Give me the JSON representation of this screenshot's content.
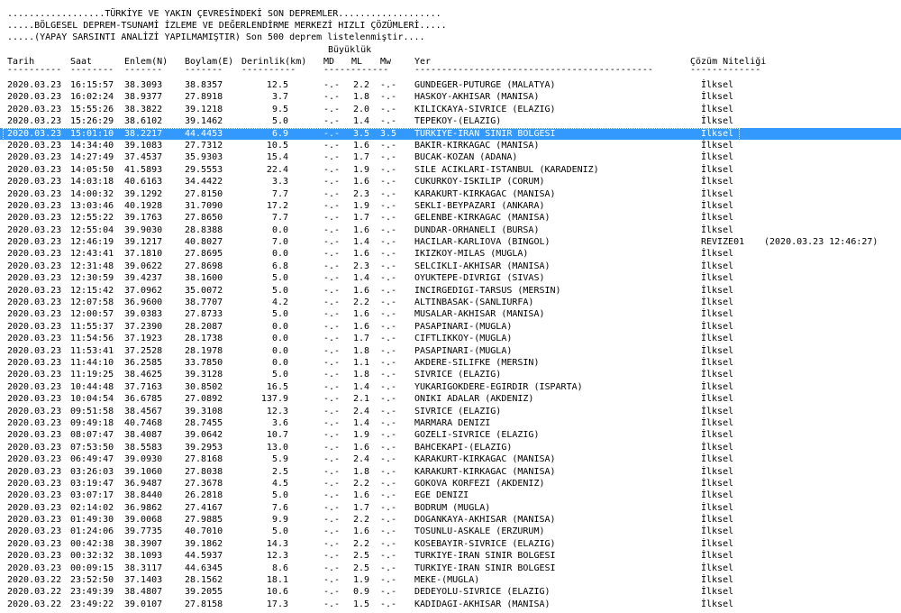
{
  "header": {
    "line1": "..................TÜRKİYE VE YAKIN ÇEVRESİNDEKİ SON DEPREMLER...................",
    "line2": ".....BÖLGESEL DEPREM-TSUNAMİ İZLEME VE DEĞERLENDİRME MERKEZİ HIZLI ÇÖZÜMLERİ.....",
    "line3": ".....(YAPAY SARSINTI ANALİZİ YAPILMAMIŞTIR) Son 500 deprem listelenmiştir....",
    "buyukluk": "Büyüklük"
  },
  "columns": {
    "tarih": "Tarih",
    "saat": "Saat",
    "enlem": "Enlem(N)",
    "boylam": "Boylam(E)",
    "derinlik": "Derinlik(km)",
    "md": "MD",
    "ml": "ML",
    "mw": "Mw",
    "yer": "Yer",
    "cozum": "Çözüm Niteliği"
  },
  "dashes": {
    "tarih": "----------",
    "saat": "--------",
    "enlem": "-------",
    "boylam": "-------",
    "derinlik": "----------",
    "mag": "------------",
    "yer": "--------------------------------------------",
    "cozum": "-------------"
  },
  "selected_row_index": 4,
  "rows": [
    {
      "tarih": "2020.03.23",
      "saat": "16:15:57",
      "enlem": "38.3093",
      "boylam": "38.8357",
      "derinlik": "12.5",
      "md": "-.-",
      "ml": "2.2",
      "mw": "-.-",
      "yer": "GUNDEGER-PUTURGE (MALATYA)",
      "cozum": "İlksel",
      "revize": ""
    },
    {
      "tarih": "2020.03.23",
      "saat": "16:02:24",
      "enlem": "38.9377",
      "boylam": "27.8918",
      "derinlik": "3.7",
      "md": "-.-",
      "ml": "1.8",
      "mw": "-.-",
      "yer": "HASKOY-AKHISAR (MANISA)",
      "cozum": "İlksel",
      "revize": ""
    },
    {
      "tarih": "2020.03.23",
      "saat": "15:55:26",
      "enlem": "38.3822",
      "boylam": "39.1218",
      "derinlik": "9.5",
      "md": "-.-",
      "ml": "2.0",
      "mw": "-.-",
      "yer": "KILICKAYA-SIVRICE (ELAZIG)",
      "cozum": "İlksel",
      "revize": ""
    },
    {
      "tarih": "2020.03.23",
      "saat": "15:26:29",
      "enlem": "38.6102",
      "boylam": "39.1462",
      "derinlik": "5.0",
      "md": "-.-",
      "ml": "1.4",
      "mw": "-.-",
      "yer": "TEPEKOY-(ELAZIG)",
      "cozum": "İlksel",
      "revize": ""
    },
    {
      "tarih": "2020.03.23",
      "saat": "15:01:10",
      "enlem": "38.2217",
      "boylam": "44.4453",
      "derinlik": "6.9",
      "md": "-.-",
      "ml": "3.5",
      "mw": "3.5",
      "yer": "TURKIYE-IRAN SINIR BOLGESI",
      "cozum": "İlksel",
      "revize": ""
    },
    {
      "tarih": "2020.03.23",
      "saat": "14:34:40",
      "enlem": "39.1083",
      "boylam": "27.7312",
      "derinlik": "10.5",
      "md": "-.-",
      "ml": "1.6",
      "mw": "-.-",
      "yer": "BAKIR-KIRKAGAC (MANISA)",
      "cozum": "İlksel",
      "revize": ""
    },
    {
      "tarih": "2020.03.23",
      "saat": "14:27:49",
      "enlem": "37.4537",
      "boylam": "35.9303",
      "derinlik": "15.4",
      "md": "-.-",
      "ml": "1.7",
      "mw": "-.-",
      "yer": "BUCAK-KOZAN (ADANA)",
      "cozum": "İlksel",
      "revize": ""
    },
    {
      "tarih": "2020.03.23",
      "saat": "14:05:50",
      "enlem": "41.5893",
      "boylam": "29.5553",
      "derinlik": "22.4",
      "md": "-.-",
      "ml": "1.9",
      "mw": "-.-",
      "yer": "SILE ACIKLARI-ISTANBUL (KARADENIZ)",
      "cozum": "İlksel",
      "revize": ""
    },
    {
      "tarih": "2020.03.23",
      "saat": "14:03:18",
      "enlem": "40.6163",
      "boylam": "34.4422",
      "derinlik": "3.3",
      "md": "-.-",
      "ml": "1.6",
      "mw": "-.-",
      "yer": "CUKURKOY-ISKILIP (CORUM)",
      "cozum": "İlksel",
      "revize": ""
    },
    {
      "tarih": "2020.03.23",
      "saat": "14:00:32",
      "enlem": "39.1292",
      "boylam": "27.8150",
      "derinlik": "7.7",
      "md": "-.-",
      "ml": "2.3",
      "mw": "-.-",
      "yer": "KARAKURT-KIRKAGAC (MANISA)",
      "cozum": "İlksel",
      "revize": ""
    },
    {
      "tarih": "2020.03.23",
      "saat": "13:03:46",
      "enlem": "40.1928",
      "boylam": "31.7090",
      "derinlik": "17.2",
      "md": "-.-",
      "ml": "1.9",
      "mw": "-.-",
      "yer": "SEKLI-BEYPAZARI (ANKARA)",
      "cozum": "İlksel",
      "revize": ""
    },
    {
      "tarih": "2020.03.23",
      "saat": "12:55:22",
      "enlem": "39.1763",
      "boylam": "27.8650",
      "derinlik": "7.7",
      "md": "-.-",
      "ml": "1.7",
      "mw": "-.-",
      "yer": "GELENBE-KIRKAGAC (MANISA)",
      "cozum": "İlksel",
      "revize": ""
    },
    {
      "tarih": "2020.03.23",
      "saat": "12:55:04",
      "enlem": "39.9030",
      "boylam": "28.8388",
      "derinlik": "0.0",
      "md": "-.-",
      "ml": "1.6",
      "mw": "-.-",
      "yer": "DUNDAR-ORHANELI (BURSA)",
      "cozum": "İlksel",
      "revize": ""
    },
    {
      "tarih": "2020.03.23",
      "saat": "12:46:19",
      "enlem": "39.1217",
      "boylam": "40.8027",
      "derinlik": "7.0",
      "md": "-.-",
      "ml": "1.4",
      "mw": "-.-",
      "yer": "HACILAR-KARLIOVA (BINGOL)",
      "cozum": "REVIZE01",
      "revize": "(2020.03.23 12:46:27)"
    },
    {
      "tarih": "2020.03.23",
      "saat": "12:43:41",
      "enlem": "37.1810",
      "boylam": "27.8695",
      "derinlik": "0.0",
      "md": "-.-",
      "ml": "1.6",
      "mw": "-.-",
      "yer": "IKIZKOY-MILAS (MUGLA)",
      "cozum": "İlksel",
      "revize": ""
    },
    {
      "tarih": "2020.03.23",
      "saat": "12:31:48",
      "enlem": "39.0622",
      "boylam": "27.8698",
      "derinlik": "6.8",
      "md": "-.-",
      "ml": "2.3",
      "mw": "-.-",
      "yer": "SELCIKLI-AKHISAR (MANISA)",
      "cozum": "İlksel",
      "revize": ""
    },
    {
      "tarih": "2020.03.23",
      "saat": "12:30:59",
      "enlem": "39.4237",
      "boylam": "38.1600",
      "derinlik": "5.0",
      "md": "-.-",
      "ml": "1.4",
      "mw": "-.-",
      "yer": "OYUKTEPE-DIVRIGI (SIVAS)",
      "cozum": "İlksel",
      "revize": ""
    },
    {
      "tarih": "2020.03.23",
      "saat": "12:15:42",
      "enlem": "37.0962",
      "boylam": "35.0072",
      "derinlik": "5.0",
      "md": "-.-",
      "ml": "1.6",
      "mw": "-.-",
      "yer": "INCIRGEDIGI-TARSUS (MERSIN)",
      "cozum": "İlksel",
      "revize": ""
    },
    {
      "tarih": "2020.03.23",
      "saat": "12:07:58",
      "enlem": "36.9600",
      "boylam": "38.7707",
      "derinlik": "4.2",
      "md": "-.-",
      "ml": "2.2",
      "mw": "-.-",
      "yer": "ALTINBASAK-(SANLIURFA)",
      "cozum": "İlksel",
      "revize": ""
    },
    {
      "tarih": "2020.03.23",
      "saat": "12:00:57",
      "enlem": "39.0383",
      "boylam": "27.8733",
      "derinlik": "5.0",
      "md": "-.-",
      "ml": "1.6",
      "mw": "-.-",
      "yer": "MUSALAR-AKHISAR (MANISA)",
      "cozum": "İlksel",
      "revize": ""
    },
    {
      "tarih": "2020.03.23",
      "saat": "11:55:37",
      "enlem": "37.2390",
      "boylam": "28.2087",
      "derinlik": "0.0",
      "md": "-.-",
      "ml": "1.6",
      "mw": "-.-",
      "yer": "PASAPINARI-(MUGLA)",
      "cozum": "İlksel",
      "revize": ""
    },
    {
      "tarih": "2020.03.23",
      "saat": "11:54:56",
      "enlem": "37.1923",
      "boylam": "28.1738",
      "derinlik": "0.0",
      "md": "-.-",
      "ml": "1.7",
      "mw": "-.-",
      "yer": "CIFTLIKKOY-(MUGLA)",
      "cozum": "İlksel",
      "revize": ""
    },
    {
      "tarih": "2020.03.23",
      "saat": "11:53:41",
      "enlem": "37.2528",
      "boylam": "28.1978",
      "derinlik": "0.0",
      "md": "-.-",
      "ml": "1.8",
      "mw": "-.-",
      "yer": "PASAPINARI-(MUGLA)",
      "cozum": "İlksel",
      "revize": ""
    },
    {
      "tarih": "2020.03.23",
      "saat": "11:44:10",
      "enlem": "36.2585",
      "boylam": "33.7850",
      "derinlik": "0.0",
      "md": "-.-",
      "ml": "1.1",
      "mw": "-.-",
      "yer": "AKDERE-SILIFKE (MERSIN)",
      "cozum": "İlksel",
      "revize": ""
    },
    {
      "tarih": "2020.03.23",
      "saat": "11:19:25",
      "enlem": "38.4625",
      "boylam": "39.3128",
      "derinlik": "5.0",
      "md": "-.-",
      "ml": "1.8",
      "mw": "-.-",
      "yer": "SIVRICE (ELAZIG)",
      "cozum": "İlksel",
      "revize": ""
    },
    {
      "tarih": "2020.03.23",
      "saat": "10:44:48",
      "enlem": "37.7163",
      "boylam": "30.8502",
      "derinlik": "16.5",
      "md": "-.-",
      "ml": "1.4",
      "mw": "-.-",
      "yer": "YUKARIGOKDERE-EGIRDIR (ISPARTA)",
      "cozum": "İlksel",
      "revize": ""
    },
    {
      "tarih": "2020.03.23",
      "saat": "10:04:54",
      "enlem": "36.6785",
      "boylam": "27.0892",
      "derinlik": "137.9",
      "md": "-.-",
      "ml": "2.1",
      "mw": "-.-",
      "yer": "ONIKI ADALAR (AKDENIZ)",
      "cozum": "İlksel",
      "revize": ""
    },
    {
      "tarih": "2020.03.23",
      "saat": "09:51:58",
      "enlem": "38.4567",
      "boylam": "39.3108",
      "derinlik": "12.3",
      "md": "-.-",
      "ml": "2.4",
      "mw": "-.-",
      "yer": "SIVRICE (ELAZIG)",
      "cozum": "İlksel",
      "revize": ""
    },
    {
      "tarih": "2020.03.23",
      "saat": "09:49:18",
      "enlem": "40.7468",
      "boylam": "28.7455",
      "derinlik": "3.6",
      "md": "-.-",
      "ml": "1.4",
      "mw": "-.-",
      "yer": "MARMARA DENIZI",
      "cozum": "İlksel",
      "revize": ""
    },
    {
      "tarih": "2020.03.23",
      "saat": "08:07:47",
      "enlem": "38.4087",
      "boylam": "39.0642",
      "derinlik": "10.7",
      "md": "-.-",
      "ml": "1.9",
      "mw": "-.-",
      "yer": "GOZELI-SIVRICE (ELAZIG)",
      "cozum": "İlksel",
      "revize": ""
    },
    {
      "tarih": "2020.03.23",
      "saat": "07:53:50",
      "enlem": "38.5583",
      "boylam": "39.2953",
      "derinlik": "13.0",
      "md": "-.-",
      "ml": "1.6",
      "mw": "-.-",
      "yer": "BAHCEKAPI-(ELAZIG)",
      "cozum": "İlksel",
      "revize": ""
    },
    {
      "tarih": "2020.03.23",
      "saat": "06:49:47",
      "enlem": "39.0930",
      "boylam": "27.8168",
      "derinlik": "5.9",
      "md": "-.-",
      "ml": "2.4",
      "mw": "-.-",
      "yer": "KARAKURT-KIRKAGAC (MANISA)",
      "cozum": "İlksel",
      "revize": ""
    },
    {
      "tarih": "2020.03.23",
      "saat": "03:26:03",
      "enlem": "39.1060",
      "boylam": "27.8038",
      "derinlik": "2.5",
      "md": "-.-",
      "ml": "1.8",
      "mw": "-.-",
      "yer": "KARAKURT-KIRKAGAC (MANISA)",
      "cozum": "İlksel",
      "revize": ""
    },
    {
      "tarih": "2020.03.23",
      "saat": "03:19:47",
      "enlem": "36.9487",
      "boylam": "27.3678",
      "derinlik": "4.5",
      "md": "-.-",
      "ml": "2.2",
      "mw": "-.-",
      "yer": "GOKOVA KORFEZI (AKDENIZ)",
      "cozum": "İlksel",
      "revize": ""
    },
    {
      "tarih": "2020.03.23",
      "saat": "03:07:17",
      "enlem": "38.8440",
      "boylam": "26.2818",
      "derinlik": "5.0",
      "md": "-.-",
      "ml": "1.6",
      "mw": "-.-",
      "yer": "EGE DENIZI",
      "cozum": "İlksel",
      "revize": ""
    },
    {
      "tarih": "2020.03.23",
      "saat": "02:14:02",
      "enlem": "36.9862",
      "boylam": "27.4167",
      "derinlik": "7.6",
      "md": "-.-",
      "ml": "1.7",
      "mw": "-.-",
      "yer": "BODRUM (MUGLA)",
      "cozum": "İlksel",
      "revize": ""
    },
    {
      "tarih": "2020.03.23",
      "saat": "01:49:30",
      "enlem": "39.0068",
      "boylam": "27.9885",
      "derinlik": "9.9",
      "md": "-.-",
      "ml": "2.2",
      "mw": "-.-",
      "yer": "DOGANKAYA-AKHISAR (MANISA)",
      "cozum": "İlksel",
      "revize": ""
    },
    {
      "tarih": "2020.03.23",
      "saat": "01:24:06",
      "enlem": "39.7735",
      "boylam": "40.7010",
      "derinlik": "5.0",
      "md": "-.-",
      "ml": "1.6",
      "mw": "-.-",
      "yer": "TOSUNLU-ASKALE (ERZURUM)",
      "cozum": "İlksel",
      "revize": ""
    },
    {
      "tarih": "2020.03.23",
      "saat": "00:42:38",
      "enlem": "38.3907",
      "boylam": "39.1862",
      "derinlik": "14.3",
      "md": "-.-",
      "ml": "2.2",
      "mw": "-.-",
      "yer": "KOSEBAYIR-SIVRICE (ELAZIG)",
      "cozum": "İlksel",
      "revize": ""
    },
    {
      "tarih": "2020.03.23",
      "saat": "00:32:32",
      "enlem": "38.1093",
      "boylam": "44.5937",
      "derinlik": "12.3",
      "md": "-.-",
      "ml": "2.5",
      "mw": "-.-",
      "yer": "TURKIYE-IRAN SINIR BOLGESI",
      "cozum": "İlksel",
      "revize": ""
    },
    {
      "tarih": "2020.03.23",
      "saat": "00:09:15",
      "enlem": "38.3117",
      "boylam": "44.6345",
      "derinlik": "8.6",
      "md": "-.-",
      "ml": "2.5",
      "mw": "-.-",
      "yer": "TURKIYE-IRAN SINIR BOLGESI",
      "cozum": "İlksel",
      "revize": ""
    },
    {
      "tarih": "2020.03.22",
      "saat": "23:52:50",
      "enlem": "37.1403",
      "boylam": "28.1562",
      "derinlik": "18.1",
      "md": "-.-",
      "ml": "1.9",
      "mw": "-.-",
      "yer": "MEKE-(MUGLA)",
      "cozum": "İlksel",
      "revize": ""
    },
    {
      "tarih": "2020.03.22",
      "saat": "23:49:39",
      "enlem": "38.4807",
      "boylam": "39.2055",
      "derinlik": "10.6",
      "md": "-.-",
      "ml": "0.9",
      "mw": "-.-",
      "yer": "DEDEYOLU-SIVRICE (ELAZIG)",
      "cozum": "İlksel",
      "revize": ""
    },
    {
      "tarih": "2020.03.22",
      "saat": "23:49:22",
      "enlem": "39.0107",
      "boylam": "27.8158",
      "derinlik": "17.3",
      "md": "-.-",
      "ml": "1.5",
      "mw": "-.-",
      "yer": "KADIDAGI-AKHISAR (MANISA)",
      "cozum": "İlksel",
      "revize": ""
    }
  ]
}
